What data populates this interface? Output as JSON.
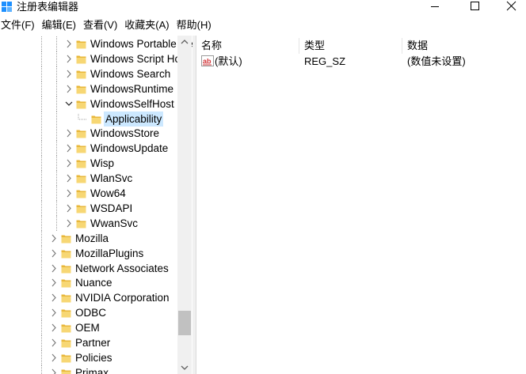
{
  "window": {
    "title": "注册表编辑器"
  },
  "menu": [
    {
      "label": "文件(F)"
    },
    {
      "label": "编辑(E)"
    },
    {
      "label": "查看(V)"
    },
    {
      "label": "收藏夹(A)"
    },
    {
      "label": "帮助(H)"
    }
  ],
  "tree": [
    {
      "label": "Windows Portable Devices",
      "level": 2,
      "toggle": "collapsed",
      "icon": "folder-icon"
    },
    {
      "label": "Windows Script Host",
      "level": 2,
      "toggle": "collapsed",
      "icon": "folder-icon"
    },
    {
      "label": "Windows Search",
      "level": 2,
      "toggle": "collapsed",
      "icon": "folder-icon"
    },
    {
      "label": "WindowsRuntime",
      "level": 2,
      "toggle": "collapsed",
      "icon": "folder-icon"
    },
    {
      "label": "WindowsSelfHost",
      "level": 2,
      "toggle": "expanded",
      "icon": "folder-icon"
    },
    {
      "label": "Applicability",
      "level": 3,
      "toggle": "none",
      "icon": "folder-icon",
      "selected": true
    },
    {
      "label": "WindowsStore",
      "level": 2,
      "toggle": "collapsed",
      "icon": "folder-icon"
    },
    {
      "label": "WindowsUpdate",
      "level": 2,
      "toggle": "collapsed",
      "icon": "folder-icon"
    },
    {
      "label": "Wisp",
      "level": 2,
      "toggle": "collapsed",
      "icon": "folder-icon"
    },
    {
      "label": "WlanSvc",
      "level": 2,
      "toggle": "collapsed",
      "icon": "folder-icon"
    },
    {
      "label": "Wow64",
      "level": 2,
      "toggle": "collapsed",
      "icon": "folder-icon"
    },
    {
      "label": "WSDAPI",
      "level": 2,
      "toggle": "collapsed",
      "icon": "folder-icon"
    },
    {
      "label": "WwanSvc",
      "level": 2,
      "toggle": "collapsed",
      "icon": "folder-icon"
    },
    {
      "label": "Mozilla",
      "level": 1,
      "toggle": "collapsed",
      "icon": "folder-icon"
    },
    {
      "label": "MozillaPlugins",
      "level": 1,
      "toggle": "collapsed",
      "icon": "folder-icon"
    },
    {
      "label": "Network Associates",
      "level": 1,
      "toggle": "collapsed",
      "icon": "folder-icon"
    },
    {
      "label": "Nuance",
      "level": 1,
      "toggle": "collapsed",
      "icon": "folder-icon"
    },
    {
      "label": "NVIDIA Corporation",
      "level": 1,
      "toggle": "collapsed",
      "icon": "folder-icon"
    },
    {
      "label": "ODBC",
      "level": 1,
      "toggle": "collapsed",
      "icon": "folder-icon"
    },
    {
      "label": "OEM",
      "level": 1,
      "toggle": "collapsed",
      "icon": "folder-icon"
    },
    {
      "label": "Partner",
      "level": 1,
      "toggle": "collapsed",
      "icon": "folder-icon"
    },
    {
      "label": "Policies",
      "level": 1,
      "toggle": "collapsed",
      "icon": "folder-icon"
    },
    {
      "label": "Primax",
      "level": 1,
      "toggle": "collapsed",
      "icon": "folder-icon"
    }
  ],
  "scrollbar": {
    "thumb_start": 0.84,
    "thumb_size": 0.08
  },
  "values": {
    "columns": {
      "name": "名称",
      "type": "类型",
      "data": "数据"
    },
    "rows": [
      {
        "icon": "string-value-icon",
        "name": "(默认)",
        "type": "REG_SZ",
        "data": "(数值未设置)"
      }
    ]
  },
  "colors": {
    "selection": "#cce8ff",
    "folder": "#f7d774",
    "scrollbar_track": "#f0f0f0",
    "scrollbar_thumb": "#c1c1c1",
    "string_icon": "#d13438"
  }
}
